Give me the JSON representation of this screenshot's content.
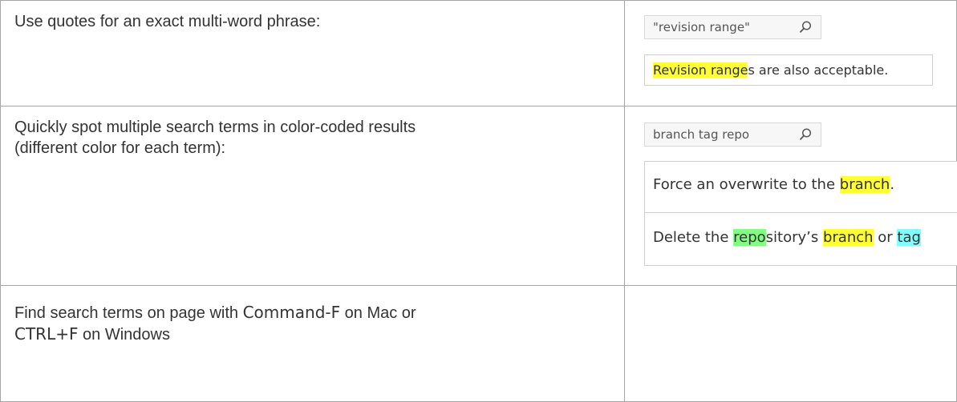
{
  "rows": [
    {
      "description": "Use quotes for an exact multi-word phrase:",
      "search_query": "\"revision range\"",
      "results": [
        {
          "parts": [
            {
              "text": "Revision range",
              "hl": "yellow"
            },
            {
              "text": "s are also acceptable."
            }
          ]
        }
      ]
    },
    {
      "description_line1": "Quickly spot multiple search terms in color-coded results",
      "description_line2": "(different color for each term):",
      "search_query": "branch tag repo",
      "results": [
        {
          "parts": [
            {
              "text": "Force an overwrite to the "
            },
            {
              "text": "branch",
              "hl": "yellow"
            },
            {
              "text": "."
            }
          ]
        },
        {
          "parts": [
            {
              "text": "Delete the "
            },
            {
              "text": "repo",
              "hl": "green"
            },
            {
              "text": "sitory’s "
            },
            {
              "text": "branch",
              "hl": "yellow"
            },
            {
              "text": " or "
            },
            {
              "text": "tag",
              "hl": "cyan"
            }
          ]
        }
      ]
    },
    {
      "text1": "Find search terms on page with ",
      "key1": "Command-F",
      "text2": " on Mac or",
      "key2": "CTRL+F",
      "text3": " on Windows"
    }
  ],
  "icon": "search-icon",
  "highlight_colors": {
    "yellow": "#ffff33",
    "green": "#80ff80",
    "cyan": "#80ffff"
  }
}
